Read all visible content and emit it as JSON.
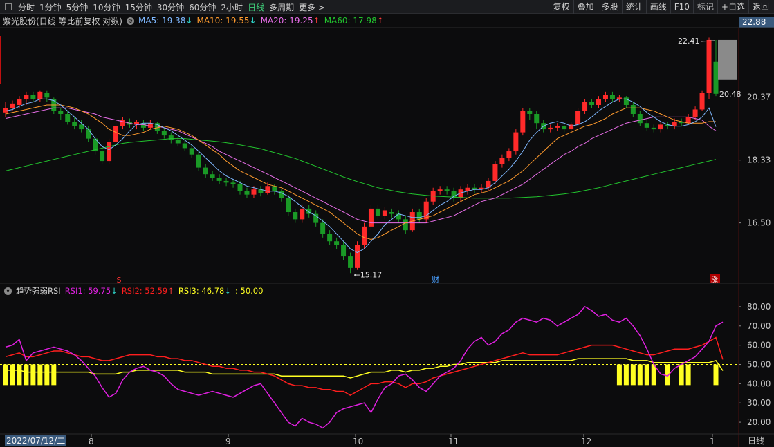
{
  "toolbar": {
    "periods": [
      "分时",
      "1分钟",
      "5分钟",
      "10分钟",
      "15分钟",
      "30分钟",
      "60分钟",
      "2小时",
      "日线",
      "多周期",
      "更多 >"
    ],
    "active": "日线",
    "right_buttons": [
      "复权",
      "叠加",
      "多股",
      "统计",
      "画线",
      "F10",
      "标记",
      "+自选",
      "返回"
    ]
  },
  "info": {
    "title": "紫光股份(日线 等比前复权 对数)",
    "ma5": "MA5: 19.38",
    "ma10": "MA10: 19.55",
    "ma20": "MA20: 19.25",
    "ma60": "MA60: 17.98",
    "ma5_arrow": "↓",
    "ma10_arrow": "↓",
    "ma20_arrow": "↑",
    "ma60_arrow": "↑"
  },
  "colors": {
    "up": "#ff2a2a",
    "down": "#1a9a26",
    "ma5": "#7fb8ff",
    "ma10": "#ff9b2e",
    "ma20": "#e86ee8",
    "ma60": "#22c42e",
    "rsi1": "#e020e0",
    "rsi2": "#ff1e1e",
    "rsi3": "#ffff22"
  },
  "price_axis": {
    "top_label": "22.88",
    "labels": [
      "20.37",
      "18.33",
      "16.50"
    ],
    "values": [
      20.37,
      18.33,
      16.5
    ]
  },
  "annotations": {
    "high": "22.41",
    "last": "20.48",
    "low": "15.17",
    "mark_cai": "财",
    "mark_zhang": "涨",
    "mark_s": "S"
  },
  "rsi": {
    "title": "趋势强弱RSI",
    "rsi1": "RSI1: 59.75",
    "rsi2": "RSI2: 52.59",
    "rsi3": "RSI3: 46.78",
    "ref": ": 50.00",
    "rsi1_arrow": "↓",
    "rsi2_arrow": "↑",
    "rsi3_arrow": "↓",
    "axis_labels": [
      "80.00",
      "70.00",
      "60.00",
      "50.00",
      "40.00",
      "30.00",
      "20.00"
    ],
    "axis_values": [
      80,
      70,
      60,
      50,
      40,
      30,
      20
    ],
    "ref_value": 50
  },
  "xaxis": {
    "date": "2022/07/12/二",
    "months": [
      "8",
      "9",
      "10",
      "11",
      "12",
      "1"
    ],
    "period_label": "日线"
  },
  "chart_data": {
    "type": "candlestick",
    "ma5_last": 19.38,
    "ma10_last": 19.55,
    "ma20_last": 19.25,
    "ma60_last": 17.98,
    "high": 22.41,
    "low": 15.17,
    "last": 20.48,
    "rsi1_last": 59.75,
    "rsi2_last": 52.59,
    "rsi3_last": 46.78,
    "candles": [
      [
        19.85,
        20.0,
        20.2,
        19.7
      ],
      [
        20.0,
        20.15,
        20.25,
        19.9
      ],
      [
        20.1,
        20.3,
        20.4,
        20.0
      ],
      [
        20.3,
        20.45,
        20.55,
        20.1
      ],
      [
        20.45,
        20.3,
        20.55,
        20.2
      ],
      [
        20.3,
        20.55,
        20.6,
        20.2
      ],
      [
        20.5,
        20.35,
        20.6,
        20.2
      ],
      [
        20.3,
        19.9,
        20.35,
        19.8
      ],
      [
        19.9,
        19.8,
        20.0,
        19.6
      ],
      [
        19.8,
        19.55,
        19.9,
        19.45
      ],
      [
        19.55,
        19.4,
        19.7,
        19.3
      ],
      [
        19.45,
        19.3,
        19.6,
        19.2
      ],
      [
        19.3,
        19.0,
        19.4,
        18.9
      ],
      [
        19.0,
        18.6,
        19.1,
        18.5
      ],
      [
        18.6,
        18.3,
        18.7,
        18.2
      ],
      [
        18.3,
        18.9,
        19.0,
        18.2
      ],
      [
        18.9,
        19.4,
        19.5,
        18.8
      ],
      [
        19.4,
        19.6,
        19.7,
        19.3
      ],
      [
        19.55,
        19.45,
        19.65,
        19.35
      ],
      [
        19.45,
        19.55,
        19.6,
        19.3
      ],
      [
        19.5,
        19.35,
        19.6,
        19.25
      ],
      [
        19.35,
        19.5,
        19.6,
        19.3
      ],
      [
        19.5,
        19.25,
        19.55,
        19.15
      ],
      [
        19.25,
        19.1,
        19.35,
        19.0
      ],
      [
        19.1,
        18.95,
        19.2,
        18.85
      ],
      [
        18.95,
        18.85,
        19.05,
        18.75
      ],
      [
        18.85,
        18.7,
        18.95,
        18.6
      ],
      [
        18.7,
        18.5,
        18.8,
        18.4
      ],
      [
        18.5,
        18.1,
        18.6,
        18.0
      ],
      [
        18.1,
        17.9,
        18.2,
        17.8
      ],
      [
        17.9,
        17.8,
        18.0,
        17.7
      ],
      [
        17.8,
        17.7,
        17.9,
        17.6
      ],
      [
        17.7,
        17.65,
        17.8,
        17.55
      ],
      [
        17.65,
        17.6,
        17.75,
        17.5
      ],
      [
        17.6,
        17.4,
        17.7,
        17.3
      ],
      [
        17.4,
        17.3,
        17.5,
        17.2
      ],
      [
        17.3,
        17.45,
        17.55,
        17.2
      ],
      [
        17.45,
        17.35,
        17.55,
        17.25
      ],
      [
        17.35,
        17.55,
        17.65,
        17.3
      ],
      [
        17.55,
        17.4,
        17.6,
        17.3
      ],
      [
        17.4,
        17.2,
        17.45,
        17.1
      ],
      [
        17.2,
        16.8,
        17.3,
        16.7
      ],
      [
        16.8,
        16.6,
        16.9,
        16.5
      ],
      [
        16.6,
        16.9,
        17.0,
        16.5
      ],
      [
        16.9,
        16.75,
        17.0,
        16.65
      ],
      [
        16.75,
        16.5,
        16.85,
        16.4
      ],
      [
        16.5,
        16.2,
        16.6,
        16.1
      ],
      [
        16.2,
        16.0,
        16.3,
        15.9
      ],
      [
        16.0,
        15.9,
        16.1,
        15.8
      ],
      [
        15.9,
        15.6,
        16.0,
        15.5
      ],
      [
        15.6,
        15.3,
        15.7,
        15.17
      ],
      [
        15.3,
        15.9,
        16.0,
        15.25
      ],
      [
        15.9,
        16.4,
        16.5,
        15.8
      ],
      [
        16.4,
        16.9,
        17.0,
        16.3
      ],
      [
        16.9,
        16.7,
        17.0,
        16.6
      ],
      [
        16.7,
        16.85,
        16.95,
        16.6
      ],
      [
        16.8,
        16.75,
        16.9,
        16.65
      ],
      [
        16.75,
        16.6,
        16.85,
        16.5
      ],
      [
        16.6,
        16.3,
        16.7,
        16.2
      ],
      [
        16.3,
        16.8,
        16.9,
        16.25
      ],
      [
        16.8,
        16.6,
        16.9,
        16.5
      ],
      [
        16.6,
        17.1,
        17.2,
        16.5
      ],
      [
        17.1,
        17.4,
        17.5,
        17.0
      ],
      [
        17.4,
        17.45,
        17.55,
        17.3
      ],
      [
        17.45,
        17.4,
        17.55,
        17.3
      ],
      [
        17.4,
        17.2,
        17.5,
        17.1
      ],
      [
        17.2,
        17.45,
        17.55,
        17.1
      ],
      [
        17.4,
        17.5,
        17.6,
        17.3
      ],
      [
        17.5,
        17.45,
        17.6,
        17.35
      ],
      [
        17.45,
        17.5,
        17.6,
        17.35
      ],
      [
        17.5,
        17.7,
        17.8,
        17.4
      ],
      [
        17.7,
        18.2,
        18.3,
        17.6
      ],
      [
        18.2,
        18.4,
        18.5,
        18.1
      ],
      [
        18.4,
        18.6,
        18.7,
        18.3
      ],
      [
        18.6,
        19.2,
        19.3,
        18.5
      ],
      [
        19.2,
        19.9,
        20.0,
        19.1
      ],
      [
        19.9,
        19.8,
        20.0,
        19.6
      ],
      [
        19.8,
        19.5,
        19.9,
        19.3
      ],
      [
        19.5,
        19.3,
        19.6,
        19.2
      ],
      [
        19.3,
        19.35,
        19.45,
        19.2
      ],
      [
        19.35,
        19.4,
        19.5,
        19.25
      ],
      [
        19.4,
        19.3,
        19.5,
        19.2
      ],
      [
        19.3,
        19.45,
        19.55,
        19.2
      ],
      [
        19.45,
        19.9,
        20.0,
        19.4
      ],
      [
        19.9,
        20.2,
        20.3,
        19.8
      ],
      [
        20.2,
        20.1,
        20.3,
        20.0
      ],
      [
        20.1,
        20.3,
        20.4,
        20.0
      ],
      [
        20.3,
        20.45,
        20.55,
        20.2
      ],
      [
        20.45,
        20.3,
        20.55,
        20.2
      ],
      [
        20.3,
        20.35,
        20.45,
        20.2
      ],
      [
        20.35,
        20.1,
        20.4,
        20.0
      ],
      [
        20.1,
        19.8,
        20.2,
        19.7
      ],
      [
        19.8,
        19.5,
        19.9,
        19.4
      ],
      [
        19.5,
        19.35,
        19.6,
        19.25
      ],
      [
        19.35,
        19.3,
        19.45,
        19.2
      ],
      [
        19.3,
        19.45,
        19.55,
        19.2
      ],
      [
        19.45,
        19.4,
        19.55,
        19.3
      ],
      [
        19.4,
        19.55,
        19.65,
        19.3
      ],
      [
        19.55,
        19.5,
        19.65,
        19.4
      ],
      [
        19.5,
        19.7,
        19.8,
        19.45
      ],
      [
        19.7,
        19.95,
        20.05,
        19.6
      ],
      [
        19.95,
        20.5,
        20.6,
        19.9
      ],
      [
        20.5,
        22.41,
        22.5,
        20.3
      ],
      [
        21.6,
        20.48,
        22.41,
        20.4
      ]
    ],
    "ma5": [
      19.9,
      19.95,
      20.05,
      20.15,
      20.2,
      20.3,
      20.3,
      20.25,
      20.1,
      19.9,
      19.7,
      19.5,
      19.3,
      19.0,
      18.75,
      18.65,
      18.8,
      19.0,
      19.25,
      19.45,
      19.5,
      19.5,
      19.45,
      19.35,
      19.25,
      19.1,
      18.95,
      18.8,
      18.6,
      18.4,
      18.2,
      18.0,
      17.85,
      17.75,
      17.65,
      17.55,
      17.5,
      17.45,
      17.4,
      17.4,
      17.35,
      17.25,
      17.1,
      16.95,
      16.8,
      16.7,
      16.55,
      16.4,
      16.2,
      16.0,
      15.8,
      15.7,
      15.8,
      16.0,
      16.2,
      16.45,
      16.6,
      16.75,
      16.7,
      16.65,
      16.65,
      16.7,
      16.85,
      17.0,
      17.1,
      17.25,
      17.35,
      17.4,
      17.45,
      17.45,
      17.5,
      17.65,
      17.85,
      18.05,
      18.3,
      18.6,
      18.95,
      19.2,
      19.4,
      19.5,
      19.55,
      19.5,
      19.4,
      19.45,
      19.55,
      19.7,
      19.9,
      20.05,
      20.2,
      20.3,
      20.3,
      20.2,
      20.05,
      19.85,
      19.7,
      19.55,
      19.45,
      19.4,
      19.4,
      19.45,
      19.55,
      19.7,
      20.0,
      19.38
    ],
    "ma10": [
      19.8,
      19.85,
      19.9,
      19.95,
      20.0,
      20.05,
      20.1,
      20.1,
      20.1,
      20.05,
      20.0,
      19.9,
      19.8,
      19.65,
      19.5,
      19.3,
      19.2,
      19.1,
      19.1,
      19.15,
      19.2,
      19.3,
      19.35,
      19.4,
      19.35,
      19.3,
      19.2,
      19.1,
      18.95,
      18.8,
      18.65,
      18.5,
      18.3,
      18.15,
      18.0,
      17.9,
      17.8,
      17.7,
      17.6,
      17.55,
      17.5,
      17.4,
      17.3,
      17.2,
      17.1,
      17.0,
      16.9,
      16.8,
      16.65,
      16.5,
      16.35,
      16.2,
      16.1,
      16.05,
      16.1,
      16.2,
      16.3,
      16.4,
      16.5,
      16.55,
      16.6,
      16.65,
      16.7,
      16.8,
      16.9,
      17.0,
      17.1,
      17.2,
      17.3,
      17.35,
      17.4,
      17.5,
      17.6,
      17.7,
      17.85,
      18.0,
      18.2,
      18.4,
      18.6,
      18.8,
      19.0,
      19.1,
      19.2,
      19.3,
      19.4,
      19.45,
      19.55,
      19.65,
      19.8,
      19.9,
      20.0,
      20.0,
      20.0,
      19.95,
      19.9,
      19.8,
      19.7,
      19.6,
      19.55,
      19.5,
      19.5,
      19.5,
      19.55,
      19.55
    ],
    "ma20": [
      19.65,
      19.7,
      19.75,
      19.8,
      19.85,
      19.9,
      19.95,
      20.0,
      20.0,
      20.0,
      19.95,
      19.9,
      19.85,
      19.8,
      19.7,
      19.65,
      19.6,
      19.55,
      19.5,
      19.45,
      19.45,
      19.4,
      19.4,
      19.35,
      19.3,
      19.25,
      19.15,
      19.05,
      18.95,
      18.85,
      18.75,
      18.6,
      18.5,
      18.4,
      18.3,
      18.2,
      18.1,
      18.0,
      17.9,
      17.8,
      17.7,
      17.6,
      17.5,
      17.4,
      17.3,
      17.2,
      17.1,
      17.0,
      16.9,
      16.8,
      16.7,
      16.6,
      16.55,
      16.5,
      16.5,
      16.5,
      16.5,
      16.5,
      16.5,
      16.5,
      16.5,
      16.5,
      16.55,
      16.6,
      16.65,
      16.7,
      16.8,
      16.9,
      17.0,
      17.1,
      17.15,
      17.2,
      17.3,
      17.4,
      17.5,
      17.6,
      17.75,
      17.9,
      18.05,
      18.2,
      18.35,
      18.5,
      18.6,
      18.75,
      18.85,
      19.0,
      19.1,
      19.2,
      19.3,
      19.4,
      19.5,
      19.55,
      19.6,
      19.65,
      19.7,
      19.7,
      19.7,
      19.7,
      19.7,
      19.7,
      19.65,
      19.6,
      19.4,
      19.25
    ],
    "ma60": [
      18.0,
      18.05,
      18.1,
      18.15,
      18.2,
      18.25,
      18.3,
      18.35,
      18.4,
      18.45,
      18.5,
      18.55,
      18.6,
      18.65,
      18.7,
      18.75,
      18.8,
      18.85,
      18.88,
      18.9,
      18.92,
      18.94,
      18.96,
      18.98,
      19.0,
      19.0,
      19.0,
      18.98,
      18.96,
      18.94,
      18.92,
      18.9,
      18.87,
      18.84,
      18.8,
      18.76,
      18.72,
      18.68,
      18.62,
      18.56,
      18.5,
      18.44,
      18.38,
      18.3,
      18.22,
      18.14,
      18.06,
      17.98,
      17.9,
      17.82,
      17.75,
      17.68,
      17.62,
      17.56,
      17.5,
      17.46,
      17.42,
      17.38,
      17.35,
      17.32,
      17.3,
      17.28,
      17.26,
      17.25,
      17.24,
      17.23,
      17.22,
      17.21,
      17.2,
      17.2,
      17.2,
      17.2,
      17.2,
      17.2,
      17.21,
      17.22,
      17.23,
      17.24,
      17.26,
      17.28,
      17.3,
      17.32,
      17.35,
      17.38,
      17.42,
      17.46,
      17.5,
      17.55,
      17.6,
      17.65,
      17.7,
      17.75,
      17.8,
      17.85,
      17.9,
      17.95,
      18.0,
      18.05,
      18.1,
      18.15,
      18.2,
      18.25,
      18.3,
      18.35
    ],
    "rsi1": [
      59,
      60,
      63,
      52,
      56,
      57,
      58,
      59,
      58,
      57,
      55,
      52,
      48,
      44,
      38,
      33,
      35,
      42,
      46,
      48,
      49,
      47,
      46,
      44,
      40,
      37,
      36,
      35,
      34,
      35,
      36,
      35,
      34,
      33,
      35,
      37,
      39,
      40,
      35,
      30,
      25,
      20,
      18,
      22,
      20,
      19,
      17,
      20,
      25,
      27,
      28,
      29,
      30,
      25,
      32,
      38,
      40,
      44,
      45,
      42,
      38,
      36,
      40,
      44,
      46,
      48,
      52,
      58,
      62,
      64,
      60,
      62,
      66,
      68,
      72,
      74,
      73,
      72,
      74,
      73,
      70,
      72,
      74,
      76,
      80,
      78,
      75,
      76,
      73,
      72,
      74,
      70,
      65,
      58,
      50,
      45,
      44,
      48,
      50,
      52,
      54,
      58,
      62,
      70,
      72
    ],
    "rsi2": [
      54,
      55,
      56,
      54,
      54,
      55,
      56,
      57,
      57,
      56,
      55,
      54,
      54,
      53,
      52,
      52,
      53,
      54,
      55,
      55,
      55,
      55,
      54,
      54,
      53,
      53,
      52,
      52,
      51,
      50,
      49,
      49,
      48,
      48,
      47,
      47,
      46,
      46,
      45,
      44,
      42,
      40,
      39,
      39,
      38,
      38,
      37,
      37,
      36,
      36,
      34,
      36,
      38,
      40,
      40,
      41,
      41,
      40,
      38,
      40,
      40,
      41,
      43,
      44,
      45,
      46,
      47,
      48,
      49,
      50,
      51,
      52,
      53,
      54,
      55,
      56,
      55,
      55,
      55,
      55,
      55,
      56,
      57,
      58,
      59,
      60,
      60,
      60,
      60,
      59,
      58,
      57,
      56,
      55,
      55,
      56,
      57,
      58,
      58,
      58,
      59,
      60,
      62,
      64,
      52.59
    ],
    "rsi3": [
      47,
      47,
      47,
      46,
      46,
      46,
      46,
      46,
      46,
      46,
      46,
      46,
      46,
      45,
      45,
      45,
      45,
      46,
      46,
      47,
      47,
      47,
      47,
      47,
      47,
      47,
      46,
      46,
      46,
      46,
      45,
      45,
      45,
      45,
      45,
      45,
      45,
      45,
      45,
      45,
      44,
      44,
      44,
      44,
      44,
      44,
      44,
      44,
      44,
      44,
      43,
      44,
      45,
      46,
      46,
      46,
      47,
      47,
      46,
      47,
      47,
      48,
      48,
      49,
      49,
      50,
      50,
      51,
      51,
      51,
      51,
      51,
      52,
      52,
      52,
      52,
      52,
      52,
      52,
      52,
      52,
      52,
      52,
      53,
      53,
      53,
      53,
      53,
      53,
      53,
      53,
      52,
      52,
      52,
      51,
      51,
      51,
      51,
      51,
      51,
      51,
      51,
      51,
      52,
      46.78
    ],
    "yellow_bars": [
      0,
      1,
      2,
      3,
      4,
      5,
      6,
      7,
      89,
      90,
      91,
      92,
      93,
      94,
      96,
      98,
      99,
      103
    ]
  }
}
